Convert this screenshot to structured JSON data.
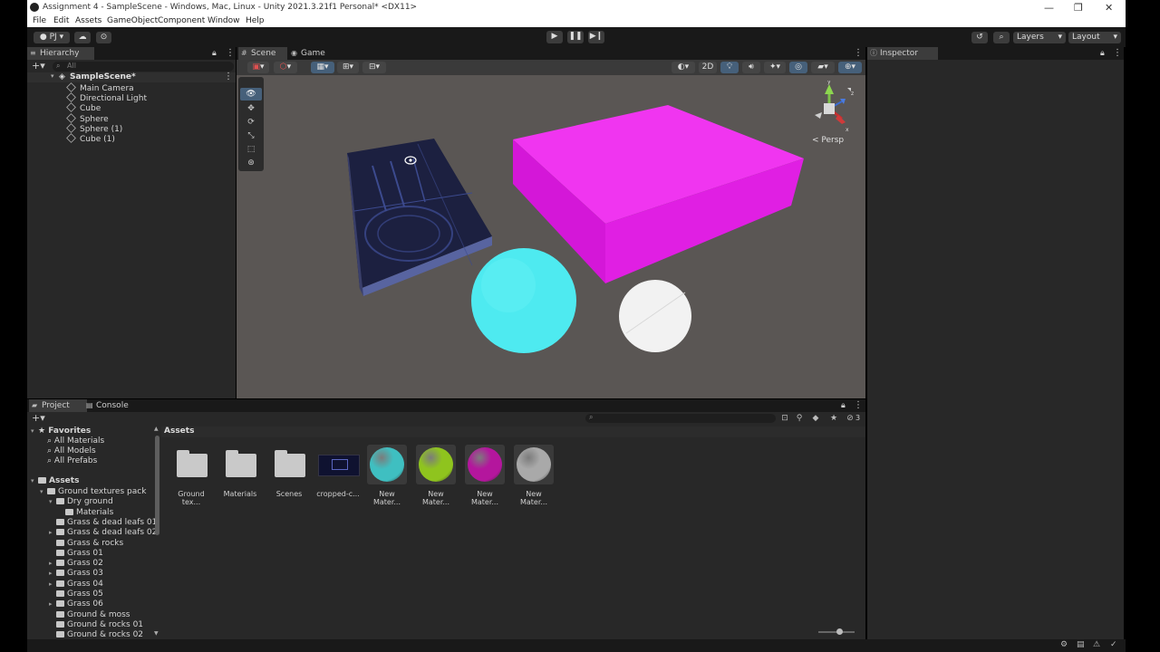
{
  "window": {
    "title": "Assignment 4 - SampleScene - Windows, Mac, Linux - Unity 2021.3.21f1 Personal* <DX11>"
  },
  "menu": [
    "File",
    "Edit",
    "Assets",
    "GameObject",
    "Component",
    "Window",
    "Help"
  ],
  "toolbar": {
    "account": "PJ",
    "layers": "Layers",
    "layout": "Layout"
  },
  "hierarchy": {
    "tab": "Hierarchy",
    "search_placeholder": "All",
    "scene": "SampleScene*",
    "items": [
      "Main Camera",
      "Directional Light",
      "Cube",
      "Sphere",
      "Sphere (1)",
      "Cube (1)"
    ]
  },
  "scene_view": {
    "tabs": [
      "Scene",
      "Game"
    ],
    "mode_2d": "2D",
    "projection": "< Persp",
    "axes": {
      "y": "y",
      "x": "x",
      "z": "z"
    },
    "objects": {
      "textured_cube": "Cube textured with cropped image",
      "magenta_cube": "#e413e8",
      "cyan_sphere": "#4ee9ef",
      "white_sphere": "#f4f4f4"
    }
  },
  "inspector": {
    "tab": "Inspector"
  },
  "project": {
    "tabs": [
      "Project",
      "Console"
    ],
    "favorites_label": "Favorites",
    "favorites": [
      "All Materials",
      "All Models",
      "All Prefabs"
    ],
    "assets_label": "Assets",
    "tree": [
      {
        "label": "Ground textures pack",
        "depth": 1,
        "expanded": true
      },
      {
        "label": "Dry ground",
        "depth": 2,
        "expanded": true
      },
      {
        "label": "Materials",
        "depth": 3
      },
      {
        "label": "Grass & dead leafs 01",
        "depth": 2
      },
      {
        "label": "Grass & dead leafs 02",
        "depth": 2,
        "has_children": true
      },
      {
        "label": "Grass & rocks",
        "depth": 2
      },
      {
        "label": "Grass 01",
        "depth": 2
      },
      {
        "label": "Grass 02",
        "depth": 2,
        "has_children": true
      },
      {
        "label": "Grass 03",
        "depth": 2,
        "has_children": true
      },
      {
        "label": "Grass 04",
        "depth": 2,
        "has_children": true
      },
      {
        "label": "Grass 05",
        "depth": 2
      },
      {
        "label": "Grass 06",
        "depth": 2,
        "has_children": true
      },
      {
        "label": "Ground & moss",
        "depth": 2
      },
      {
        "label": "Ground & rocks 01",
        "depth": 2
      },
      {
        "label": "Ground & rocks 02",
        "depth": 2
      }
    ],
    "breadcrumb": "Assets",
    "hidden_count": "3",
    "assets": [
      {
        "label": "Ground tex...",
        "kind": "folder"
      },
      {
        "label": "Materials",
        "kind": "folder"
      },
      {
        "label": "Scenes",
        "kind": "folder"
      },
      {
        "label": "cropped-c...",
        "kind": "texture"
      },
      {
        "label": "New Mater...",
        "kind": "material",
        "color": "#3fbfc1"
      },
      {
        "label": "New Mater...",
        "kind": "material",
        "color": "#8fc41e"
      },
      {
        "label": "New Mater...",
        "kind": "material",
        "color": "#b4169d"
      },
      {
        "label": "New Mater...",
        "kind": "material",
        "color": "#a9a9a9"
      }
    ]
  }
}
